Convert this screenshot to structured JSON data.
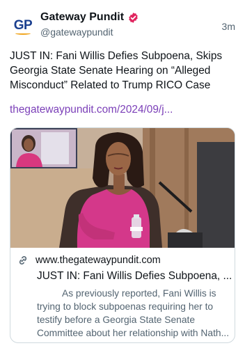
{
  "account": {
    "logo_text": "GP",
    "display_name": "Gateway Pundit",
    "handle": "@gatewaypundit",
    "time_ago": "3m",
    "verified_color": "#e0245e"
  },
  "post": {
    "text": "JUST IN: Fani Willis Defies Subpoena, Skips Georgia State Senate Hearing on “Alleged Misconduct” Related to Trump RICO Case",
    "link_text": "thegatewaypundit.com/2024/09/j...",
    "link_color": "#7b3fb8"
  },
  "card": {
    "domain": "www.thegatewaypundit.com",
    "title": "JUST IN: Fani Willis Defies Subpoena, ...",
    "description": "As previously reported, Fani Willis is trying to block subpoenas requiring her to testify before a Georgia State Senate Committee about her relationship with Nath..."
  }
}
